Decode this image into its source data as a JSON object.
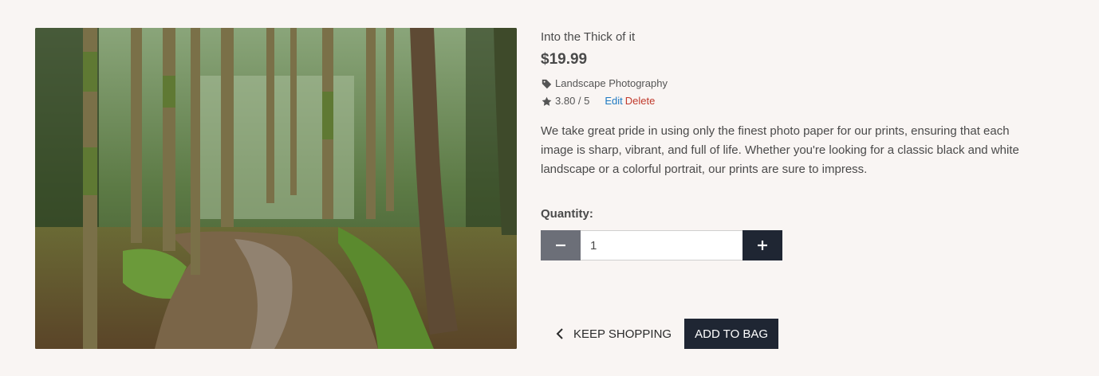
{
  "product": {
    "name": "Into the Thick of it",
    "price": "$19.99",
    "category": "Landscape Photography",
    "rating": "3.80 / 5",
    "edit_label": "Edit",
    "delete_label": "Delete",
    "description": "We take great pride in using only the finest photo paper for our prints, ensuring that each image is sharp, vibrant, and full of life. Whether you're looking for a classic black and white landscape or a colorful portrait, our prints are sure to impress.",
    "image_icon": "forest-path-photo"
  },
  "quantity": {
    "label": "Quantity:",
    "value": "1",
    "minus_icon": "minus-icon",
    "plus_icon": "plus-icon"
  },
  "actions": {
    "keep_shopping": "KEEP SHOPPING",
    "add_to_bag": "ADD TO BAG"
  },
  "colors": {
    "background": "#f9f5f3",
    "dark_button": "#1f2633",
    "minus_button": "#6c6f78",
    "edit_link": "#1f7ac2",
    "delete_link": "#c0392b"
  }
}
